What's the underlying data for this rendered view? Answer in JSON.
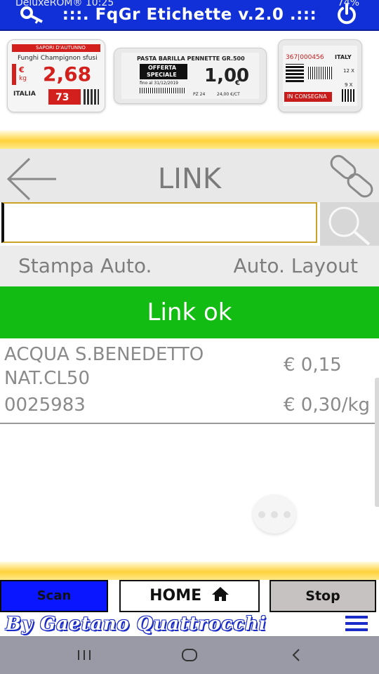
{
  "status_bar": {
    "left_text": "DeluxeROM® 10:25",
    "right_text": "74%"
  },
  "app_bar": {
    "title": ":::. FqGr Etichette v.2.0 .:::",
    "key_icon": "key-icon",
    "power_icon": "power-icon"
  },
  "banner": {
    "label1": {
      "header": "SAPORI D'AUTUNNO",
      "product": "Funghi Champignon sfusi",
      "currency": "€",
      "unit": "kg",
      "price": "2,68",
      "origin": "ITALIA",
      "box_price": "73"
    },
    "label2": {
      "product": "PASTA BARILLA PENNETTE GR.500",
      "promo_line1": "OFFERTA",
      "promo_line2": "SPECIALE",
      "promo_date": "fino al 31/12/2019",
      "price": "1,00",
      "currency": "€",
      "pieces": "PZ 24",
      "unit_price": "24,00 €/CT"
    },
    "label3": {
      "code": "367|000456",
      "country": "ITALY",
      "qty1": "12 X",
      "qty2": "9 X",
      "status": "IN CONSEGNA"
    }
  },
  "header": {
    "title": "LINK",
    "back_icon": "arrow-left-icon",
    "chain_icon": "chain-link-icon"
  },
  "search": {
    "value": "",
    "placeholder": "",
    "button_icon": "search-icon"
  },
  "options": {
    "auto_print": "Stampa Auto.",
    "auto_layout": "Auto. Layout"
  },
  "status_message": "Link ok",
  "product": {
    "name": "ACQUA S.BENEDETTO NAT.CL50",
    "price": "€ 0,15",
    "code": "0025983",
    "unit_price": "€ 0,30/kg"
  },
  "bottom_buttons": {
    "scan": "Scan",
    "home": "HOME",
    "stop": "Stop",
    "scan_color": "#0a16ff",
    "stop_color": "#c7c2c2"
  },
  "footer": {
    "credit": "By Gaetano Quattrocchi",
    "menu_icon": "hamburger-menu-icon"
  },
  "colors": {
    "app_bar": "#1230d8",
    "success": "#12bc12",
    "accent_yellow": "#ffd23c"
  }
}
